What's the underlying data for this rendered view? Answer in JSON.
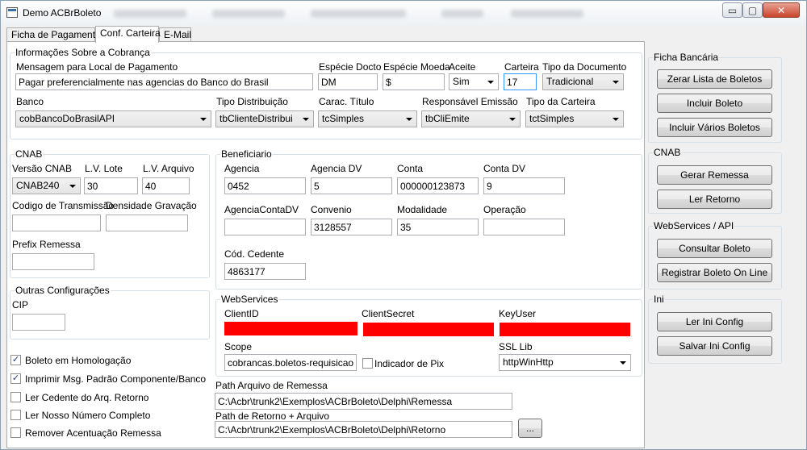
{
  "window": {
    "title": "Demo ACBrBoleto",
    "minimize": "▭",
    "maximize": "▢",
    "close": "✕"
  },
  "tabs": [
    "Ficha de Pagamento",
    "Conf. Carteira",
    "E-Mail"
  ],
  "cobranca": {
    "title": "Informações Sobre a Cobrança",
    "mensagem_label": "Mensagem para Local de Pagamento",
    "mensagem_value": "Pagar preferencialmente nas agencias do Banco do Brasil",
    "especie_docto_label": "Espécie Docto",
    "especie_docto_value": "DM",
    "especie_moeda_label": "Espécie Moeda",
    "especie_moeda_value": "$",
    "aceite_label": "Aceite",
    "aceite_value": "Sim",
    "carteira_label": "Carteira",
    "carteira_value": "17",
    "tipo_documento_label": "Tipo da Documento",
    "tipo_documento_value": "Tradicional",
    "banco_label": "Banco",
    "banco_value": "cobBancoDoBrasilAPI",
    "tipo_distribuicao_label": "Tipo Distribuição",
    "tipo_distribuicao_value": "tbClienteDistribui",
    "carac_titulo_label": "Carac. Título",
    "carac_titulo_value": "tcSimples",
    "responsavel_emissao_label": "Responsável Emissão",
    "responsavel_emissao_value": "tbCliEmite",
    "tipo_carteira_label": "Tipo da Carteira",
    "tipo_carteira_value": "tctSimples"
  },
  "cnab": {
    "title": "CNAB",
    "versao_label": "Versão CNAB",
    "versao_value": "CNAB240",
    "lv_lote_label": "L.V. Lote",
    "lv_lote_value": "30",
    "lv_arquivo_label": "L.V. Arquivo",
    "lv_arquivo_value": "40",
    "codigo_transmissao_label": "Codigo de Transmissão",
    "codigo_transmissao_value": "",
    "densidade_label": "Densidade Gravação",
    "densidade_value": "",
    "prefix_remessa_label": "Prefix Remessa",
    "prefix_remessa_value": ""
  },
  "outras": {
    "title": "Outras Configurações",
    "cip_label": "CIP",
    "cip_value": ""
  },
  "checkboxes": [
    {
      "label": "Boleto em Homologação",
      "checked": true,
      "mark": "✓"
    },
    {
      "label": "Imprimir Msg. Padrão Componente/Banco",
      "checked": true,
      "mark": "✓"
    },
    {
      "label": "Ler Cedente do Arq. Retorno",
      "checked": false,
      "mark": ""
    },
    {
      "label": "Ler Nosso Número Completo",
      "checked": false,
      "mark": ""
    },
    {
      "label": "Remover Acentuação Remessa",
      "checked": false,
      "mark": ""
    }
  ],
  "beneficiario": {
    "title": "Beneficiario",
    "agencia_label": "Agencia",
    "agencia_value": "0452",
    "agencia_dv_label": "Agencia DV",
    "agencia_dv_value": "5",
    "conta_label": "Conta",
    "conta_value": "000000123873",
    "conta_dv_label": "Conta DV",
    "conta_dv_value": "9",
    "agencia_conta_dv_label": "AgenciaContaDV",
    "agencia_conta_dv_value": "",
    "convenio_label": "Convenio",
    "convenio_value": "3128557",
    "modalidade_label": "Modalidade",
    "modalidade_value": "35",
    "operacao_label": "Operação",
    "operacao_value": "",
    "cod_cedente_label": "Cód. Cedente",
    "cod_cedente_value": "4863177"
  },
  "webservices": {
    "title": "WebServices",
    "client_id_label": "ClientID",
    "client_secret_label": "ClientSecret",
    "key_user_label": "KeyUser",
    "scope_label": "Scope",
    "scope_value": "cobrancas.boletos-requisicao",
    "indicador_pix_label": "Indicador de Pix",
    "ssl_lib_label": "SSL Lib",
    "ssl_lib_value": "httpWinHttp",
    "redaction_color": "#ff0000"
  },
  "paths": {
    "remessa_label": "Path Arquivo de Remessa",
    "remessa_value": "C:\\Acbr\\trunk2\\Exemplos\\ACBrBoleto\\Delphi\\Remessa",
    "retorno_label": "Path de Retorno + Arquivo",
    "retorno_value": "C:\\Acbr\\trunk2\\Exemplos\\ACBrBoleto\\Delphi\\Retorno",
    "browse_label": "..."
  },
  "side": {
    "ficha": {
      "title": "Ficha Bancária",
      "zerar": "Zerar Lista de Boletos",
      "incluir": "Incluir Boleto",
      "incluir_varios": "Incluir Vários Boletos"
    },
    "cnab": {
      "title": "CNAB",
      "gerar": "Gerar Remessa",
      "ler": "Ler Retorno"
    },
    "webservices": {
      "title": "WebServices / API",
      "consultar": "Consultar Boleto",
      "registrar": "Registrar Boleto On Line"
    },
    "ini": {
      "title": "Ini",
      "ler": "Ler Ini Config",
      "salvar": "Salvar Ini Config"
    }
  }
}
